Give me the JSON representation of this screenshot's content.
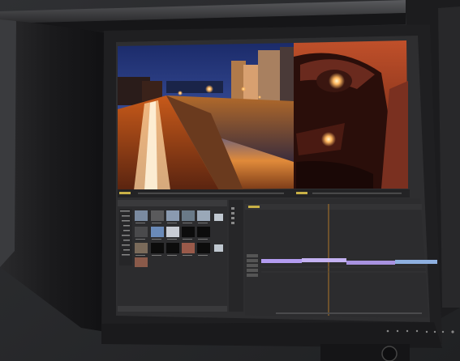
{
  "scene": {
    "subject": "monitor-with-shading-hood",
    "bezel_color": "#1f1f21",
    "hood_color": "#1b1b1d",
    "background_color": "#2b2b2d"
  },
  "viewer": {
    "left_image": "night-city-river-long-exposure",
    "right_image": "car-headlight-warm-toned"
  },
  "project_panel": {
    "thumbnail_count": 15,
    "tree_rows": 10
  },
  "timeline": {
    "clips_on_track_1": 4,
    "accent_clip_color": "#b39cf0",
    "playhead_color": "#d08a2a",
    "ruler_mark_color": "#c8b046"
  },
  "bezel_controls": {
    "button_count": 8
  }
}
